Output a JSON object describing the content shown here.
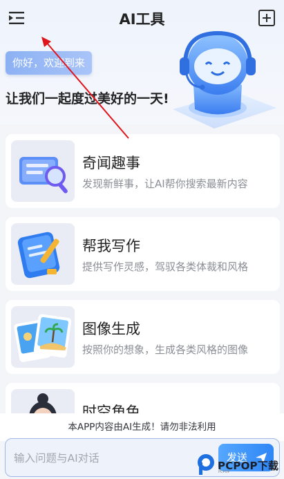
{
  "header": {
    "title": "AI工具",
    "menu_icon": "sidebar-menu-icon",
    "add_icon": "plus-square-icon"
  },
  "greeting": {
    "bubble": "你好，欢迎到来",
    "line": "让我们一起度过美好的一天!"
  },
  "cards": [
    {
      "title": "奇闻趣事",
      "desc": "发现新鲜事，让AI帮你搜索最新内容",
      "icon": "search-document-icon"
    },
    {
      "title": "帮我写作",
      "desc": "提供写作灵感，驾驭各类体裁和风格",
      "icon": "notebook-pen-icon"
    },
    {
      "title": "图像生成",
      "desc": "按照你的想象，生成各类风格的图像",
      "icon": "photo-icon"
    },
    {
      "title": "时空角色",
      "desc": "",
      "icon": "character-avatar-icon"
    }
  ],
  "footer": {
    "notice": "本APP内容由AI生成！请勿非法利用",
    "input_placeholder": "输入问题与AI对话",
    "send_label": "发送"
  },
  "watermark": {
    "text": "PCPOP下载",
    "sub": "PCPOP"
  },
  "colors": {
    "accent": "#2f86f6",
    "bubble": "#8cb1f3",
    "arrow": "#e0151c"
  }
}
